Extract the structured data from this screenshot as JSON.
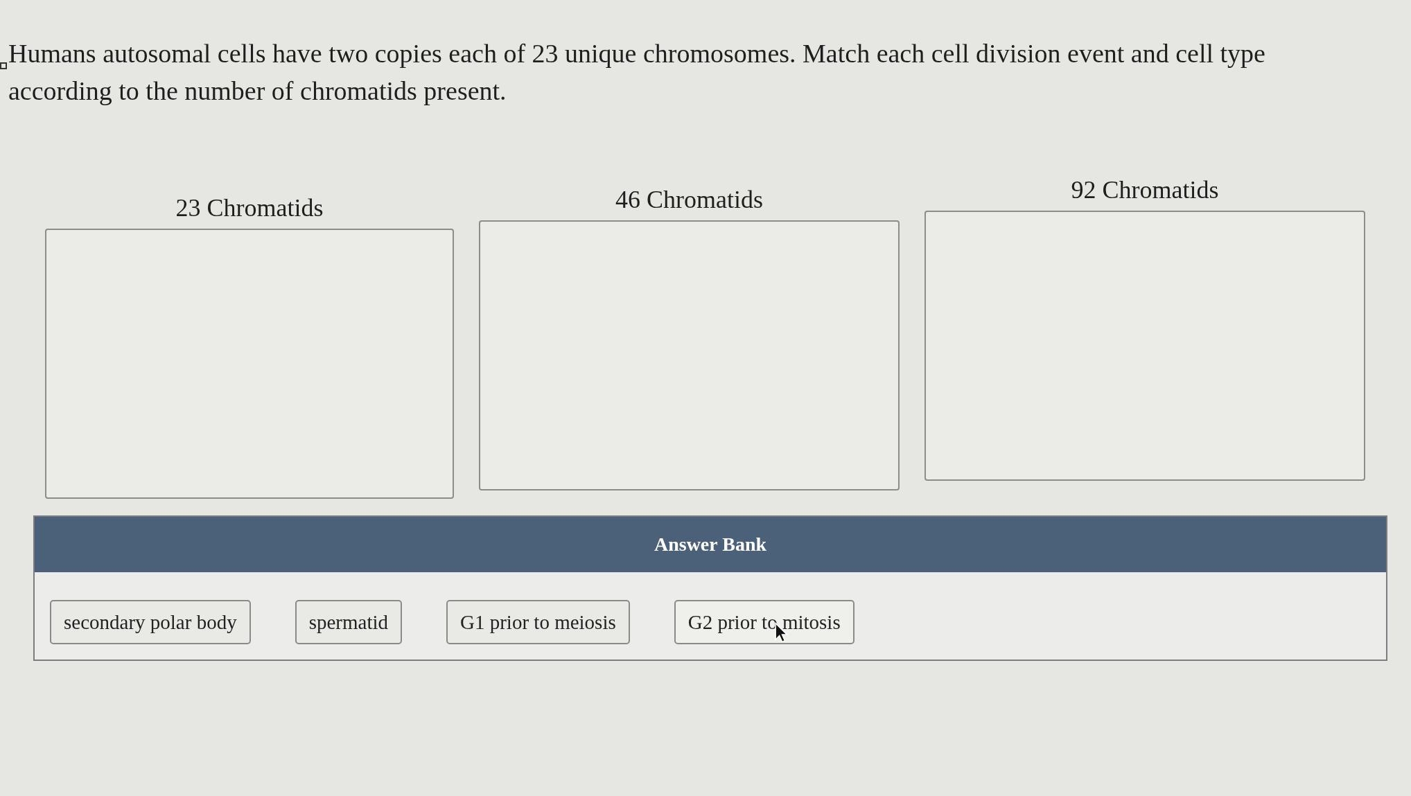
{
  "question": {
    "text": "Humans autosomal cells have two copies each of 23 unique chromosomes. Match each cell division event and cell type according to the number of chromatids present."
  },
  "targets": [
    {
      "label": "23 Chromatids"
    },
    {
      "label": "46 Chromatids"
    },
    {
      "label": "92 Chromatids"
    }
  ],
  "answer_bank": {
    "title": "Answer Bank",
    "items": [
      "secondary polar body",
      "spermatid",
      "G1 prior to meiosis",
      "G2 prior to mitosis"
    ]
  }
}
